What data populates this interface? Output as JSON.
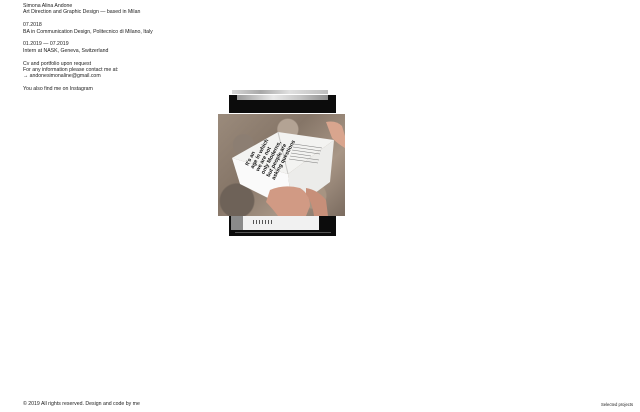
{
  "intro": {
    "name": "Simona Alina Andone",
    "role": "Art Direction and Graphic Design — based in Milan"
  },
  "education": {
    "date": "07.2018",
    "detail": "BA in Communication Design, Politecnico di Milano, Italy"
  },
  "internship": {
    "date": "01.2019 — 07.2019",
    "detail": "Intern at NASK, Geneva, Switzerland"
  },
  "contact": {
    "cv_note": "Cv and portfolio upon request",
    "info_note": "For any information please contact me at:",
    "email": "→ andonesimonaline@gmail.com"
  },
  "instagram": {
    "text": "You also find me on Instagram"
  },
  "photo": {
    "page_text": "It's an age in which we are not only Moderns, but people are asking questions on their own bodies to find answers to"
  },
  "footer": {
    "copyright": "© 2019 All rights reserved. Design and code by me",
    "selected_projects": "Selected projects"
  }
}
